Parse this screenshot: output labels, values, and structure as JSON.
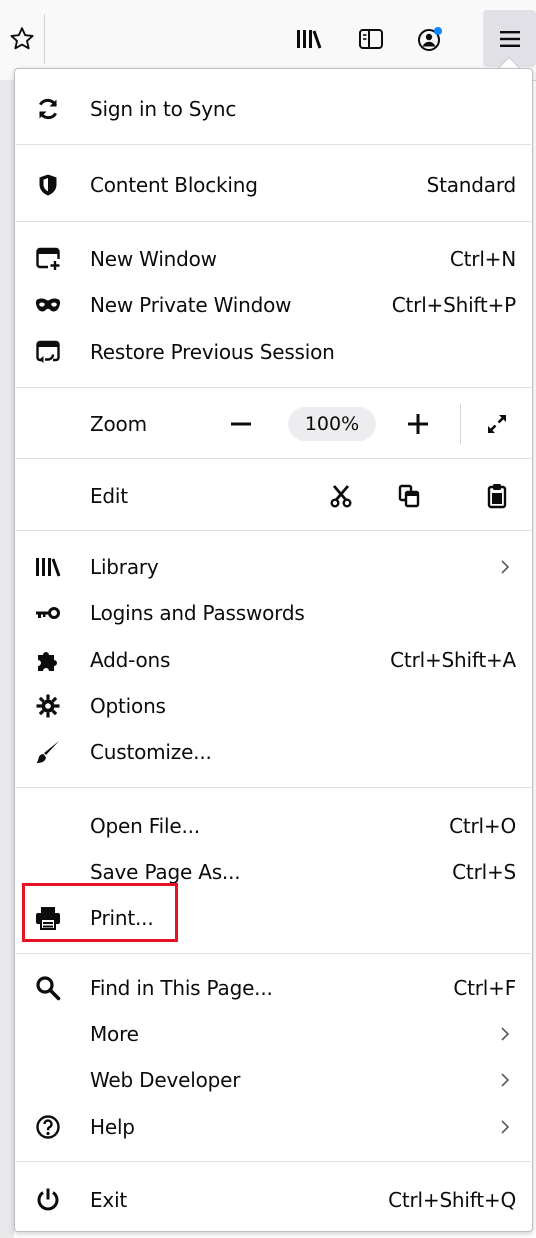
{
  "toolbar": {
    "icons": [
      "star-icon",
      "library-icon",
      "sidebar-icon",
      "account-icon",
      "hamburger-menu-icon"
    ],
    "account_badge_color": "#0a84ff",
    "menu_button_bg": "#e0e0e6"
  },
  "menu": {
    "sync": {
      "label": "Sign in to Sync",
      "icon": "sync-icon"
    },
    "content_blocking": {
      "label": "Content Blocking",
      "value": "Standard",
      "icon": "shield-icon"
    },
    "new_window": {
      "label": "New Window",
      "shortcut": "Ctrl+N",
      "icon": "new-window-icon"
    },
    "new_private_window": {
      "label": "New Private Window",
      "shortcut": "Ctrl+Shift+P",
      "icon": "private-mask-icon"
    },
    "restore_session": {
      "label": "Restore Previous Session",
      "icon": "restore-session-icon"
    },
    "zoom": {
      "label": "Zoom",
      "value": "100%",
      "minus": "−",
      "plus": "+"
    },
    "edit": {
      "label": "Edit"
    },
    "library": {
      "label": "Library",
      "icon": "library-icon"
    },
    "logins": {
      "label": "Logins and Passwords",
      "icon": "key-icon"
    },
    "addons": {
      "label": "Add-ons",
      "shortcut": "Ctrl+Shift+A",
      "icon": "puzzle-icon"
    },
    "options": {
      "label": "Options",
      "icon": "gear-icon"
    },
    "customize": {
      "label": "Customize...",
      "icon": "brush-icon"
    },
    "open_file": {
      "label": "Open File...",
      "shortcut": "Ctrl+O"
    },
    "save_page": {
      "label": "Save Page As...",
      "shortcut": "Ctrl+S"
    },
    "print": {
      "label": "Print...",
      "icon": "printer-icon",
      "highlight_color": "#e81123"
    },
    "find": {
      "label": "Find in This Page...",
      "shortcut": "Ctrl+F",
      "icon": "search-icon"
    },
    "more": {
      "label": "More"
    },
    "web_developer": {
      "label": "Web Developer"
    },
    "help": {
      "label": "Help",
      "icon": "help-icon"
    },
    "exit": {
      "label": "Exit",
      "shortcut": "Ctrl+Shift+Q",
      "icon": "power-icon"
    }
  }
}
